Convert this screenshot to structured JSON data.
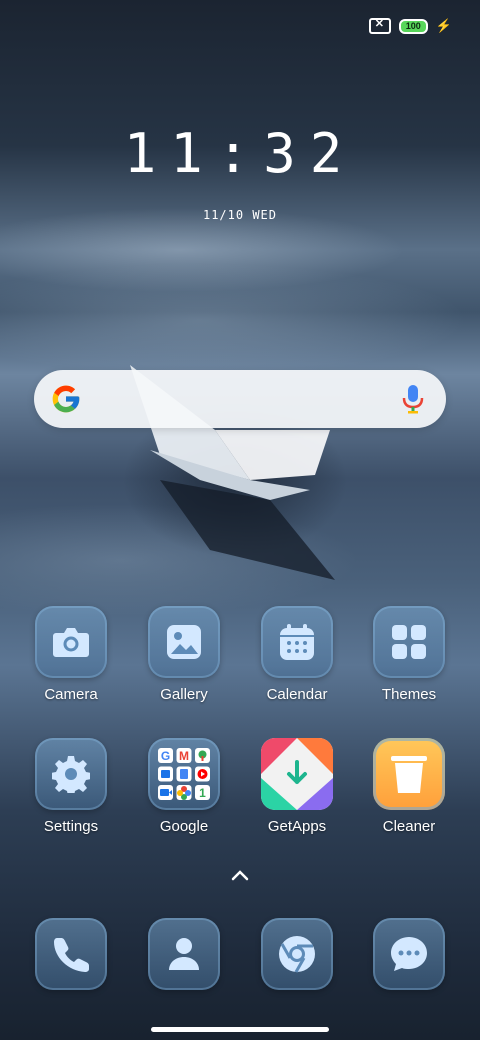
{
  "status_bar": {
    "battery": "100",
    "sim_icon": "no-sim-icon",
    "charging_icon": "bolt-icon"
  },
  "lock": {
    "time": "11:32",
    "date": "11/10 WED"
  },
  "search": {
    "logo": "google-g-icon",
    "mic": "microphone-icon"
  },
  "apps": [
    {
      "label": "Camera",
      "icon": "camera-icon"
    },
    {
      "label": "Gallery",
      "icon": "gallery-icon"
    },
    {
      "label": "Calendar",
      "icon": "calendar-icon"
    },
    {
      "label": "Themes",
      "icon": "themes-icon"
    },
    {
      "label": "Settings",
      "icon": "gear-icon"
    },
    {
      "label": "Google",
      "icon": "google-folder-icon"
    },
    {
      "label": "GetApps",
      "icon": "getapps-icon"
    },
    {
      "label": "Cleaner",
      "icon": "trash-icon"
    }
  ],
  "dock": [
    {
      "icon": "phone-icon"
    },
    {
      "icon": "contacts-icon"
    },
    {
      "icon": "chrome-icon"
    },
    {
      "icon": "messages-icon"
    }
  ],
  "colors": {
    "accent_icon": "#cfe6ff",
    "battery": "#58d65a",
    "getapps_red": "#ef4a6a",
    "cleaner": "#ffb74a"
  }
}
